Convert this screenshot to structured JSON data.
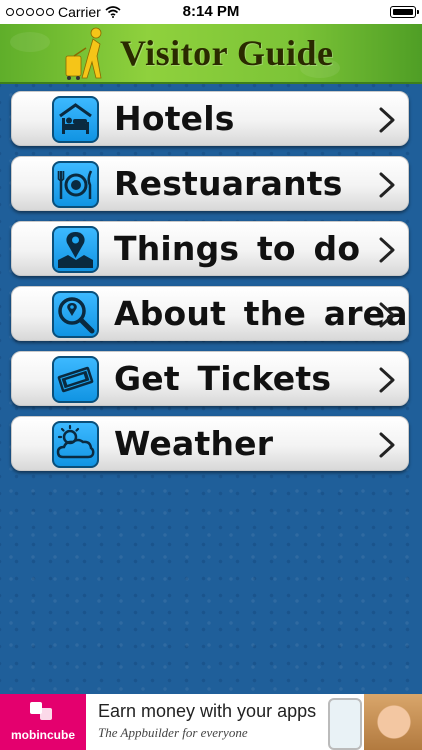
{
  "status_bar": {
    "carrier": "Carrier",
    "time": "8:14 PM"
  },
  "header": {
    "title": "Visitor Guide"
  },
  "menu": {
    "items": [
      {
        "label": "Hotels",
        "icon": "hotel-bed-icon"
      },
      {
        "label": "Restuarants",
        "icon": "plate-fork-knife-icon"
      },
      {
        "label": "Things to do",
        "icon": "map-pin-icon"
      },
      {
        "label": "About the area",
        "icon": "magnifier-pin-icon"
      },
      {
        "label": "Get Tickets",
        "icon": "ticket-icon"
      },
      {
        "label": "Weather",
        "icon": "sun-cloud-icon"
      }
    ]
  },
  "ad": {
    "brand": "mobincube",
    "headline": "Earn money with your apps",
    "subline": "The Appbuilder for everyone"
  },
  "colors": {
    "header_green": "#7cc437",
    "background_blue": "#1f5f9a",
    "icon_blue": "#1ea6f0",
    "ad_pink": "#e4006e"
  }
}
